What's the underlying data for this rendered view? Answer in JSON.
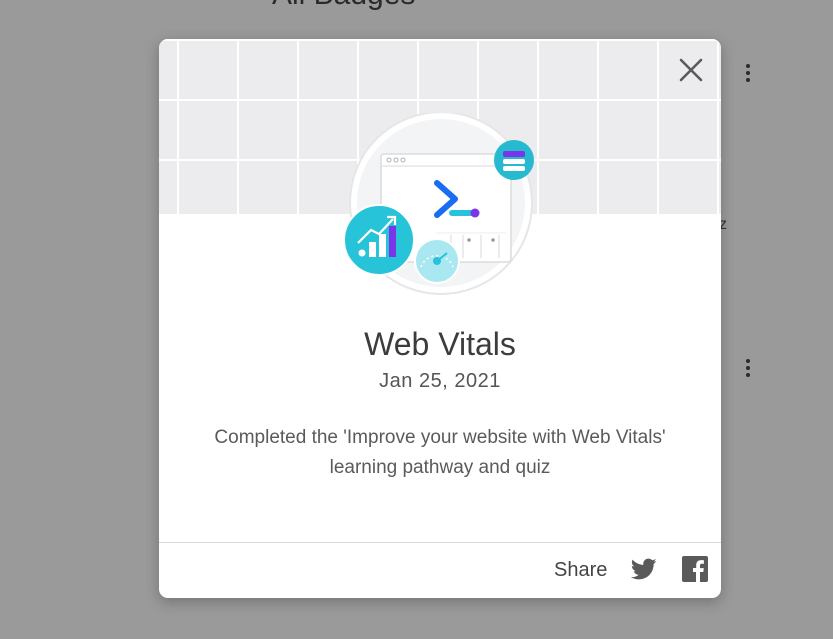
{
  "background": {
    "heading": "All Badges",
    "partial_letter": "z",
    "menu_icon": "more-vert-icon"
  },
  "dialog": {
    "close_icon": "close-icon",
    "badge_icon": "web-vitals-badge-icon",
    "title": "Web Vitals",
    "date": "Jan 25, 2021",
    "description": "Completed the 'Improve your website with Web Vitals' learning pathway and quiz",
    "share_label": "Share",
    "share_icons": [
      "twitter-icon",
      "facebook-icon"
    ]
  },
  "colors": {
    "overlay": "#9a9a9a",
    "grid_bg": "#ececee",
    "teal": "#27c3d8",
    "blue": "#1a6cf0",
    "purple": "#7b35e8"
  }
}
